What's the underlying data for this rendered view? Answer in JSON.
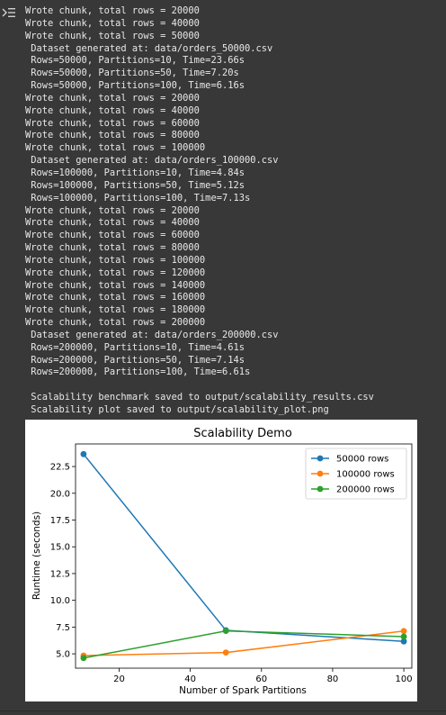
{
  "output_lines": [
    "Wrote chunk, total rows = 20000",
    "Wrote chunk, total rows = 40000",
    "Wrote chunk, total rows = 50000",
    " Dataset generated at: data/orders_50000.csv",
    " Rows=50000, Partitions=10, Time=23.66s",
    " Rows=50000, Partitions=50, Time=7.20s",
    " Rows=50000, Partitions=100, Time=6.16s",
    "Wrote chunk, total rows = 20000",
    "Wrote chunk, total rows = 40000",
    "Wrote chunk, total rows = 60000",
    "Wrote chunk, total rows = 80000",
    "Wrote chunk, total rows = 100000",
    " Dataset generated at: data/orders_100000.csv",
    " Rows=100000, Partitions=10, Time=4.84s",
    " Rows=100000, Partitions=50, Time=5.12s",
    " Rows=100000, Partitions=100, Time=7.13s",
    "Wrote chunk, total rows = 20000",
    "Wrote chunk, total rows = 40000",
    "Wrote chunk, total rows = 60000",
    "Wrote chunk, total rows = 80000",
    "Wrote chunk, total rows = 100000",
    "Wrote chunk, total rows = 120000",
    "Wrote chunk, total rows = 140000",
    "Wrote chunk, total rows = 160000",
    "Wrote chunk, total rows = 180000",
    "Wrote chunk, total rows = 200000",
    " Dataset generated at: data/orders_200000.csv",
    " Rows=200000, Partitions=10, Time=4.61s",
    " Rows=200000, Partitions=50, Time=7.14s",
    " Rows=200000, Partitions=100, Time=6.61s",
    "",
    " Scalability benchmark saved to output/scalability_results.csv",
    " Scalability plot saved to output/scalability_plot.png"
  ],
  "gutter_icon": "output-collapse-icon",
  "colors": {
    "background": "#383838",
    "text": "#e8e8e8"
  },
  "chart_data": {
    "type": "line",
    "title": "Scalability Demo",
    "xlabel": "Number of Spark Partitions",
    "ylabel": "Runtime (seconds)",
    "xlim": [
      7.75,
      102.25
    ],
    "ylim": [
      3.66,
      24.61
    ],
    "xticks": [
      20,
      40,
      60,
      80,
      100
    ],
    "yticks": [
      5.0,
      7.5,
      10.0,
      12.5,
      15.0,
      17.5,
      20.0,
      22.5
    ],
    "xtick_labels": [
      "20",
      "40",
      "60",
      "80",
      "100"
    ],
    "ytick_labels": [
      "5.0",
      "7.5",
      "10.0",
      "12.5",
      "15.0",
      "17.5",
      "20.0",
      "22.5"
    ],
    "legend_position": "top-right",
    "grid": false,
    "x": [
      10,
      50,
      100
    ],
    "series": [
      {
        "name": "50000 rows",
        "color": "#1f77b4",
        "values": [
          23.66,
          7.2,
          6.16
        ]
      },
      {
        "name": "100000 rows",
        "color": "#ff7f0e",
        "values": [
          4.84,
          5.12,
          7.13
        ]
      },
      {
        "name": "200000 rows",
        "color": "#2ca02c",
        "values": [
          4.61,
          7.14,
          6.61
        ]
      }
    ]
  }
}
